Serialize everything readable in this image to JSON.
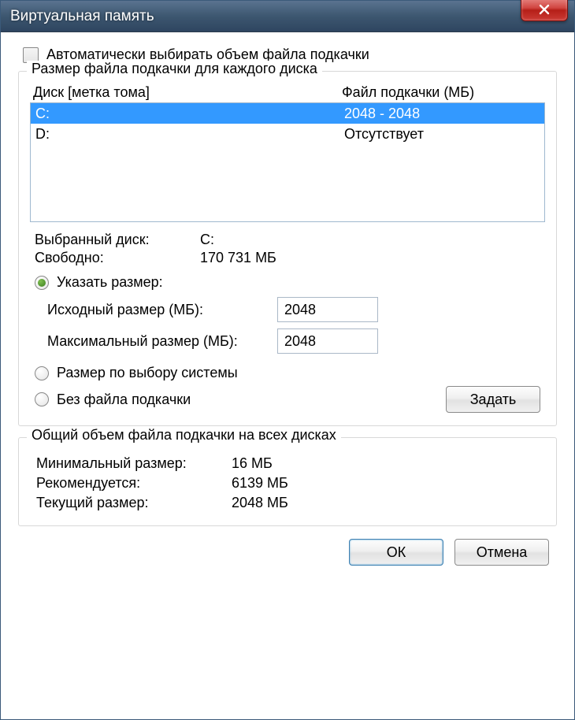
{
  "window": {
    "title": "Виртуальная память"
  },
  "auto": {
    "label": "Автоматически выбирать объем файла подкачки",
    "checked": false
  },
  "perdrive": {
    "title": "Размер файла подкачки для каждого диска",
    "col_drive": "Диск [метка тома]",
    "col_paging": "Файл подкачки (МБ)",
    "rows": [
      {
        "drive": "C:",
        "paging": "2048 - 2048",
        "selected": true
      },
      {
        "drive": "D:",
        "paging": "Отсутствует",
        "selected": false
      }
    ],
    "selected_label": "Выбранный диск:",
    "selected_value": "C:",
    "free_label": "Свободно:",
    "free_value": "170 731 МБ",
    "radio_custom": "Указать размер:",
    "initial_label": "Исходный размер (МБ):",
    "initial_value": "2048",
    "max_label": "Максимальный размер (МБ):",
    "max_value": "2048",
    "radio_system": "Размер по выбору системы",
    "radio_none": "Без файла подкачки",
    "set_button": "Задать",
    "radio_selected": "custom"
  },
  "totals": {
    "title": "Общий объем файла подкачки на всех дисках",
    "min_label": "Минимальный размер:",
    "min_value": "16 МБ",
    "rec_label": "Рекомендуется:",
    "rec_value": "6139 МБ",
    "cur_label": "Текущий размер:",
    "cur_value": "2048 МБ"
  },
  "buttons": {
    "ok": "ОК",
    "cancel": "Отмена"
  }
}
